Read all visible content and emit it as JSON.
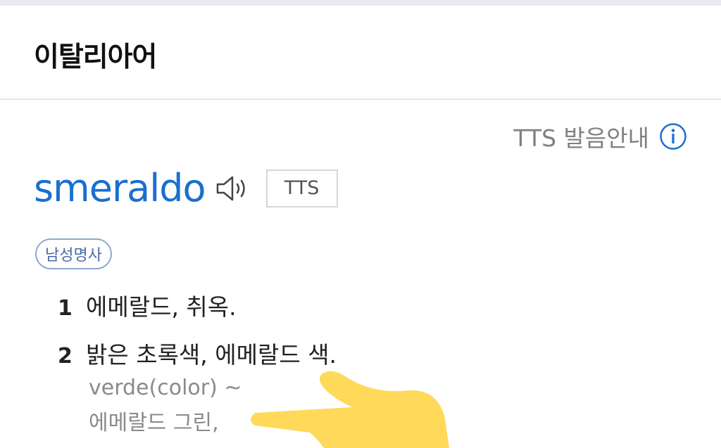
{
  "header": {
    "title": "이탈리아어"
  },
  "tts_guide": {
    "label": "TTS 발음안내",
    "icon": "info-icon"
  },
  "entry": {
    "word": "smeraldo",
    "speaker_icon": "speaker-icon",
    "tts_button": "TTS",
    "part_of_speech": "남성명사"
  },
  "senses": [
    {
      "num": "1",
      "text": "에메랄드, 취옥."
    },
    {
      "num": "2",
      "text": "밝은 초록색, 에메랄드 색.",
      "examples": [
        "verde(color) ~",
        "에메랄드 그린,"
      ]
    }
  ],
  "colors": {
    "word": "#1a6fcf",
    "accent": "#1a6fcf",
    "finger": "#ffd95a"
  }
}
